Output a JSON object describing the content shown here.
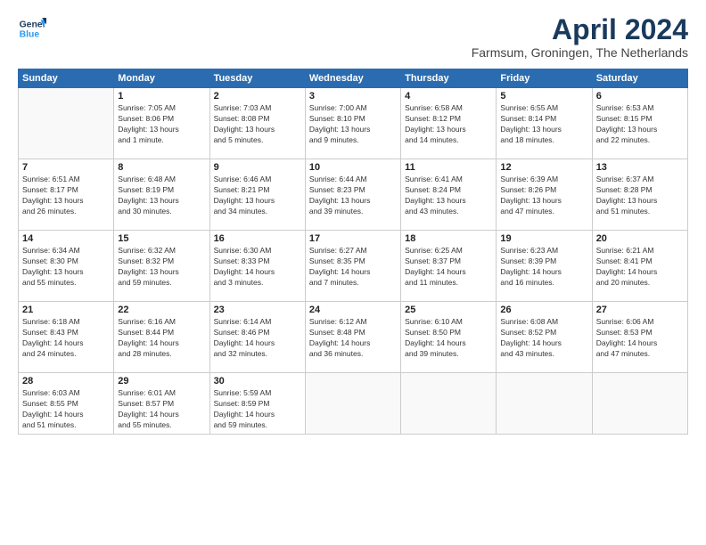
{
  "header": {
    "logo_line1": "General",
    "logo_line2": "Blue",
    "month_title": "April 2024",
    "location": "Farmsum, Groningen, The Netherlands"
  },
  "weekdays": [
    "Sunday",
    "Monday",
    "Tuesday",
    "Wednesday",
    "Thursday",
    "Friday",
    "Saturday"
  ],
  "weeks": [
    [
      {
        "day": "",
        "info": ""
      },
      {
        "day": "1",
        "info": "Sunrise: 7:05 AM\nSunset: 8:06 PM\nDaylight: 13 hours\nand 1 minute."
      },
      {
        "day": "2",
        "info": "Sunrise: 7:03 AM\nSunset: 8:08 PM\nDaylight: 13 hours\nand 5 minutes."
      },
      {
        "day": "3",
        "info": "Sunrise: 7:00 AM\nSunset: 8:10 PM\nDaylight: 13 hours\nand 9 minutes."
      },
      {
        "day": "4",
        "info": "Sunrise: 6:58 AM\nSunset: 8:12 PM\nDaylight: 13 hours\nand 14 minutes."
      },
      {
        "day": "5",
        "info": "Sunrise: 6:55 AM\nSunset: 8:14 PM\nDaylight: 13 hours\nand 18 minutes."
      },
      {
        "day": "6",
        "info": "Sunrise: 6:53 AM\nSunset: 8:15 PM\nDaylight: 13 hours\nand 22 minutes."
      }
    ],
    [
      {
        "day": "7",
        "info": "Sunrise: 6:51 AM\nSunset: 8:17 PM\nDaylight: 13 hours\nand 26 minutes."
      },
      {
        "day": "8",
        "info": "Sunrise: 6:48 AM\nSunset: 8:19 PM\nDaylight: 13 hours\nand 30 minutes."
      },
      {
        "day": "9",
        "info": "Sunrise: 6:46 AM\nSunset: 8:21 PM\nDaylight: 13 hours\nand 34 minutes."
      },
      {
        "day": "10",
        "info": "Sunrise: 6:44 AM\nSunset: 8:23 PM\nDaylight: 13 hours\nand 39 minutes."
      },
      {
        "day": "11",
        "info": "Sunrise: 6:41 AM\nSunset: 8:24 PM\nDaylight: 13 hours\nand 43 minutes."
      },
      {
        "day": "12",
        "info": "Sunrise: 6:39 AM\nSunset: 8:26 PM\nDaylight: 13 hours\nand 47 minutes."
      },
      {
        "day": "13",
        "info": "Sunrise: 6:37 AM\nSunset: 8:28 PM\nDaylight: 13 hours\nand 51 minutes."
      }
    ],
    [
      {
        "day": "14",
        "info": "Sunrise: 6:34 AM\nSunset: 8:30 PM\nDaylight: 13 hours\nand 55 minutes."
      },
      {
        "day": "15",
        "info": "Sunrise: 6:32 AM\nSunset: 8:32 PM\nDaylight: 13 hours\nand 59 minutes."
      },
      {
        "day": "16",
        "info": "Sunrise: 6:30 AM\nSunset: 8:33 PM\nDaylight: 14 hours\nand 3 minutes."
      },
      {
        "day": "17",
        "info": "Sunrise: 6:27 AM\nSunset: 8:35 PM\nDaylight: 14 hours\nand 7 minutes."
      },
      {
        "day": "18",
        "info": "Sunrise: 6:25 AM\nSunset: 8:37 PM\nDaylight: 14 hours\nand 11 minutes."
      },
      {
        "day": "19",
        "info": "Sunrise: 6:23 AM\nSunset: 8:39 PM\nDaylight: 14 hours\nand 16 minutes."
      },
      {
        "day": "20",
        "info": "Sunrise: 6:21 AM\nSunset: 8:41 PM\nDaylight: 14 hours\nand 20 minutes."
      }
    ],
    [
      {
        "day": "21",
        "info": "Sunrise: 6:18 AM\nSunset: 8:43 PM\nDaylight: 14 hours\nand 24 minutes."
      },
      {
        "day": "22",
        "info": "Sunrise: 6:16 AM\nSunset: 8:44 PM\nDaylight: 14 hours\nand 28 minutes."
      },
      {
        "day": "23",
        "info": "Sunrise: 6:14 AM\nSunset: 8:46 PM\nDaylight: 14 hours\nand 32 minutes."
      },
      {
        "day": "24",
        "info": "Sunrise: 6:12 AM\nSunset: 8:48 PM\nDaylight: 14 hours\nand 36 minutes."
      },
      {
        "day": "25",
        "info": "Sunrise: 6:10 AM\nSunset: 8:50 PM\nDaylight: 14 hours\nand 39 minutes."
      },
      {
        "day": "26",
        "info": "Sunrise: 6:08 AM\nSunset: 8:52 PM\nDaylight: 14 hours\nand 43 minutes."
      },
      {
        "day": "27",
        "info": "Sunrise: 6:06 AM\nSunset: 8:53 PM\nDaylight: 14 hours\nand 47 minutes."
      }
    ],
    [
      {
        "day": "28",
        "info": "Sunrise: 6:03 AM\nSunset: 8:55 PM\nDaylight: 14 hours\nand 51 minutes."
      },
      {
        "day": "29",
        "info": "Sunrise: 6:01 AM\nSunset: 8:57 PM\nDaylight: 14 hours\nand 55 minutes."
      },
      {
        "day": "30",
        "info": "Sunrise: 5:59 AM\nSunset: 8:59 PM\nDaylight: 14 hours\nand 59 minutes."
      },
      {
        "day": "",
        "info": ""
      },
      {
        "day": "",
        "info": ""
      },
      {
        "day": "",
        "info": ""
      },
      {
        "day": "",
        "info": ""
      }
    ]
  ]
}
